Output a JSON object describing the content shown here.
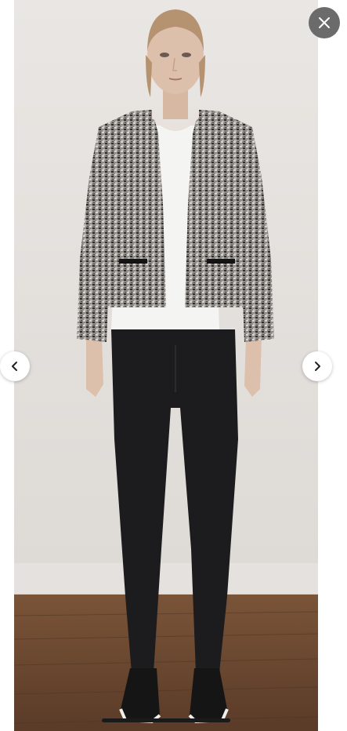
{
  "viewer": {
    "close_icon": "close-icon",
    "prev_icon": "chevron-left-icon",
    "next_icon": "chevron-right-icon"
  },
  "photo": {
    "subject": "product-photo"
  },
  "colors": {
    "wall": "#e6e3e0",
    "floor": "#6e4a33",
    "jacket": "#8f8c88",
    "tee": "#f4f4f2",
    "jeans": "#1c1c1e",
    "skin": "#dcc0ac",
    "hair": "#b59270",
    "close_button": "#6b6b6b"
  }
}
